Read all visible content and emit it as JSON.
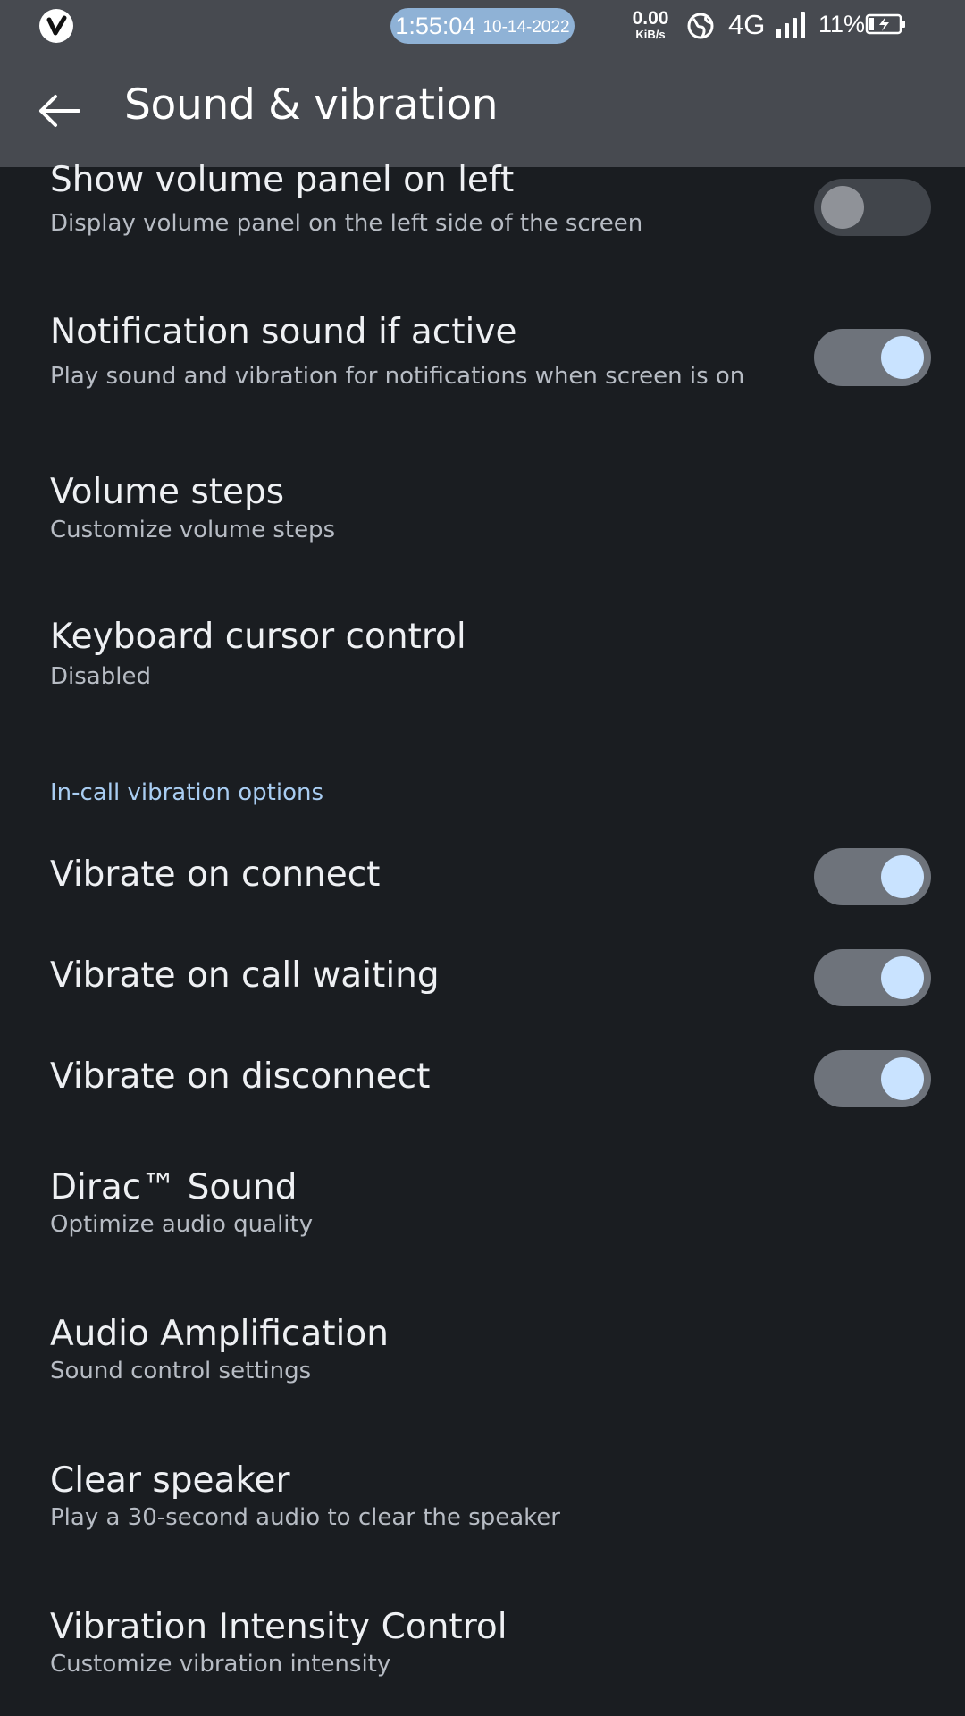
{
  "status_bar": {
    "time": "1:55:04",
    "date": "10-14-2022",
    "speed_value": "0.00",
    "speed_unit": "KiB/s",
    "network": "4G",
    "battery": "11%",
    "icons": [
      "app-logo-icon",
      "globe-icon",
      "signal-icon",
      "battery-charging-icon"
    ]
  },
  "app_bar": {
    "title": "Sound & vibration",
    "back_icon": "arrow-left-icon"
  },
  "settings": {
    "show_volume_panel_left": {
      "title": "Show volume panel on left",
      "subtitle": "Display volume panel on the left side of the screen",
      "enabled": false
    },
    "notification_sound_active": {
      "title": "Notification sound if active",
      "subtitle": "Play sound and vibration for notifications when screen is on",
      "enabled": true
    },
    "volume_steps": {
      "title": "Volume steps",
      "subtitle": "Customize volume steps"
    },
    "keyboard_cursor": {
      "title": "Keyboard cursor control",
      "subtitle": "Disabled"
    },
    "in_call_header": "In-call vibration options",
    "vibrate_connect": {
      "title": "Vibrate on connect",
      "enabled": true
    },
    "vibrate_call_waiting": {
      "title": "Vibrate on call waiting",
      "enabled": true
    },
    "vibrate_disconnect": {
      "title": "Vibrate on disconnect",
      "enabled": true
    },
    "dirac": {
      "title": "Dirac™ Sound",
      "subtitle": "Optimize audio quality"
    },
    "audio_amplification": {
      "title": "Audio Amplification",
      "subtitle": "Sound control settings"
    },
    "clear_speaker": {
      "title": "Clear speaker",
      "subtitle": "Play a 30-second audio to clear the speaker"
    },
    "vibration_intensity": {
      "title": "Vibration Intensity Control",
      "subtitle": "Customize vibration intensity"
    }
  },
  "colors": {
    "background": "#1a1d21",
    "app_bar": "#474a50",
    "accent": "#c9e3ff",
    "section_header": "#a9cdf2",
    "clock_pill": "#8fb2d6"
  }
}
